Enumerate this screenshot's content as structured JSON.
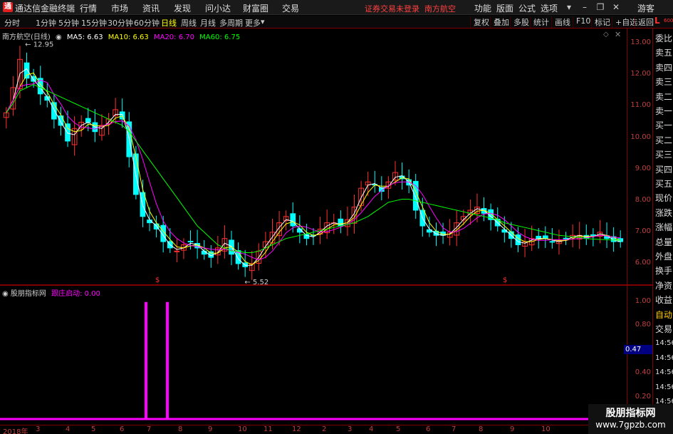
{
  "app": {
    "title": "通达信金融终端",
    "logo": "通"
  },
  "menu": [
    "行情",
    "市场",
    "资讯",
    "发现",
    "问小达",
    "财富圈",
    "交易"
  ],
  "notice": {
    "text": "证券交易未登录",
    "stock": "南方航空"
  },
  "right_menu": [
    "功能",
    "版面",
    "公式",
    "选项"
  ],
  "window": {
    "user": "游客"
  },
  "periods": [
    {
      "label": "分时",
      "active": false
    },
    {
      "label": "1分钟",
      "active": false
    },
    {
      "label": "5分钟",
      "active": false
    },
    {
      "label": "15分钟",
      "active": false
    },
    {
      "label": "30分钟",
      "active": false
    },
    {
      "label": "60分钟",
      "active": false
    },
    {
      "label": "日线",
      "active": true
    },
    {
      "label": "周线",
      "active": false
    },
    {
      "label": "月线",
      "active": false
    },
    {
      "label": "多周期",
      "active": false
    },
    {
      "label": "更多",
      "active": false
    }
  ],
  "toolbar_buttons": [
    "复权",
    "叠加",
    "多股",
    "统计",
    "画线",
    "F10",
    "标记",
    "+自选",
    "返回"
  ],
  "main_legend": {
    "name": "南方航空(日线)",
    "ma5": "MA5: 6.63",
    "ma10": "MA10: 6.63",
    "ma20": "MA20: 6.70",
    "ma60": "MA60: 6.75"
  },
  "indicator_legend": {
    "name": "股朋指标网",
    "line": "跟庄启动: 0.00"
  },
  "indicator_value": "0.47",
  "right_panel": {
    "badge": "L",
    "code": "600029",
    "items": [
      "委比",
      "卖五",
      "卖四",
      "卖三",
      "卖二",
      "卖一",
      "买一",
      "买二",
      "买三",
      "买四",
      "买五",
      "现价",
      "涨跌",
      "涨幅",
      "总量",
      "外盘",
      "换手",
      "净资",
      "收益",
      "自动",
      "交易",
      "14:56",
      "14:56",
      "14:56",
      "14:56",
      "14:56",
      "14:56",
      "14:56",
      "14:56"
    ]
  },
  "watermark": {
    "line1": "股朋指标网",
    "line2": "www.7gpzb.com"
  },
  "colors": {
    "up": "#ff3030",
    "down": "#00ffff",
    "ma5": "#ffffff",
    "ma10": "#ffff00",
    "ma20": "#ff00ff",
    "ma60": "#00ff00",
    "indicator": "#ff00ff",
    "axis": "#c04040"
  },
  "chart_data": [
    {
      "type": "candlestick",
      "title": "南方航空(日线)",
      "ylim": [
        5.5,
        13.3
      ],
      "y_ticks": [
        13.0,
        12.0,
        11.0,
        10.0,
        9.0,
        8.0,
        7.0,
        6.0
      ],
      "x_ticks": [
        "2018年",
        "3",
        "4",
        "5",
        "6",
        "7",
        "8",
        "9",
        "10",
        "11",
        "12",
        "2",
        "3",
        "4",
        "5",
        "6",
        "7",
        "8",
        "9",
        "10"
      ],
      "annotations": [
        {
          "text": "12.95"
        },
        {
          "text": "5.52"
        }
      ],
      "close": [
        10.8,
        11.6,
        12.5,
        11.9,
        11.8,
        11.4,
        11.2,
        10.6,
        10.4,
        9.9,
        10.3,
        10.5,
        10.5,
        10.2,
        10.4,
        10.6,
        10.9,
        10.6,
        9.4,
        8.2,
        7.5,
        7.3,
        7.1,
        6.7,
        6.5,
        6.4,
        6.6,
        6.7,
        6.5,
        6.3,
        6.2,
        6.5,
        6.8,
        6.3,
        6.0,
        5.9,
        6.0,
        6.4,
        6.7,
        7.0,
        7.3,
        7.5,
        7.2,
        7.0,
        6.8,
        6.9,
        7.1,
        7.3,
        7.3,
        7.2,
        7.4,
        7.8,
        8.4,
        8.6,
        8.5,
        8.3,
        8.6,
        8.9,
        8.7,
        8.5,
        7.7,
        7.2,
        7.0,
        6.9,
        6.9,
        7.0,
        7.3,
        7.5,
        7.7,
        7.8,
        7.6,
        7.4,
        7.2,
        7.0,
        6.8,
        6.6,
        6.7,
        6.8,
        6.8,
        6.8,
        6.7,
        6.7,
        6.8,
        6.9,
        6.9,
        6.8,
        6.9,
        7.0,
        6.8,
        6.7,
        6.7
      ],
      "ma60": [
        10.8,
        11.1,
        11.5,
        11.6,
        11.7,
        11.6,
        11.5,
        11.4,
        11.3,
        11.2,
        11.1,
        11.0,
        10.9,
        10.8,
        10.7,
        10.6,
        10.5,
        10.4,
        10.2,
        9.9,
        9.6,
        9.3,
        9.0,
        8.7,
        8.4,
        8.1,
        7.8,
        7.5,
        7.2,
        7.0,
        6.8,
        6.6,
        6.5,
        6.4,
        6.4,
        6.35,
        6.35,
        6.4,
        6.5,
        6.6,
        6.7,
        6.8,
        6.85,
        6.9,
        6.95,
        7.0,
        7.05,
        7.1,
        7.15,
        7.2,
        7.25,
        7.3,
        7.4,
        7.5,
        7.65,
        7.8,
        7.95,
        8.0,
        8.05,
        8.05,
        8.0,
        7.95,
        7.9,
        7.85,
        7.8,
        7.75,
        7.7,
        7.65,
        7.6,
        7.55,
        7.5,
        7.45,
        7.4,
        7.3,
        7.25,
        7.2,
        7.15,
        7.1,
        7.05,
        7.0,
        6.95,
        6.9,
        6.88,
        6.85,
        6.83,
        6.8,
        6.78,
        6.77,
        6.76,
        6.75,
        6.75
      ]
    },
    {
      "type": "bar",
      "title": "股朋指标网",
      "series": [
        {
          "name": "跟庄启动",
          "spikes_at_month": [
            "6-7",
            "7"
          ],
          "values": [
            1.0,
            1.0
          ]
        }
      ],
      "ylim": [
        0.0,
        1.1
      ],
      "y_ticks": [
        1.0,
        0.8,
        0.6,
        0.4,
        0.2
      ]
    }
  ]
}
